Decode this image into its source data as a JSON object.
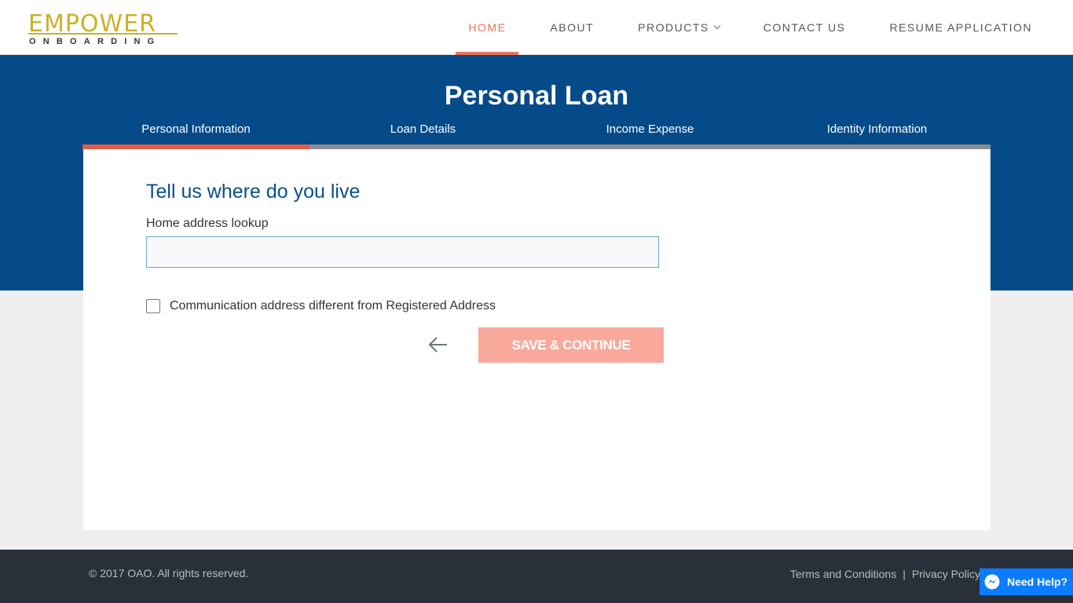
{
  "brand": {
    "name": "EMPOWER",
    "tagline": "ONBOARDING",
    "color": "#c9b12a"
  },
  "nav": {
    "items": [
      {
        "label": "HOME",
        "active": true
      },
      {
        "label": "ABOUT",
        "active": false
      },
      {
        "label": "PRODUCTS",
        "active": false,
        "has_dropdown": true
      },
      {
        "label": "CONTACT US",
        "active": false
      },
      {
        "label": "RESUME APPLICATION",
        "active": false
      }
    ]
  },
  "page": {
    "title": "Personal Loan"
  },
  "steps": {
    "items": [
      {
        "label": "Personal Information"
      },
      {
        "label": "Loan Details"
      },
      {
        "label": "Income Expense"
      },
      {
        "label": "Identity Information"
      }
    ],
    "progress_fraction": 0.25
  },
  "form": {
    "section_title": "Tell us where do you live",
    "address_label": "Home address lookup",
    "address_value": "",
    "checkbox_label": "Communication address different from Registered Address",
    "checkbox_checked": false,
    "save_label": "SAVE & CONTINUE"
  },
  "footer": {
    "copyright": "© 2017 OAO. All rights reserved.",
    "terms": "Terms and Conditions",
    "separator": "|",
    "privacy": "Privacy Policy"
  },
  "help": {
    "label": "Need Help?"
  },
  "colors": {
    "primary": "#054b8a",
    "accent": "#e8735f",
    "save_button": "#f8a99c",
    "footer": "#2a3039",
    "help": "#0a7cff"
  },
  "icons": {
    "dropdown": "chevron-down-icon",
    "back": "arrow-left-icon",
    "help": "messenger-icon"
  }
}
